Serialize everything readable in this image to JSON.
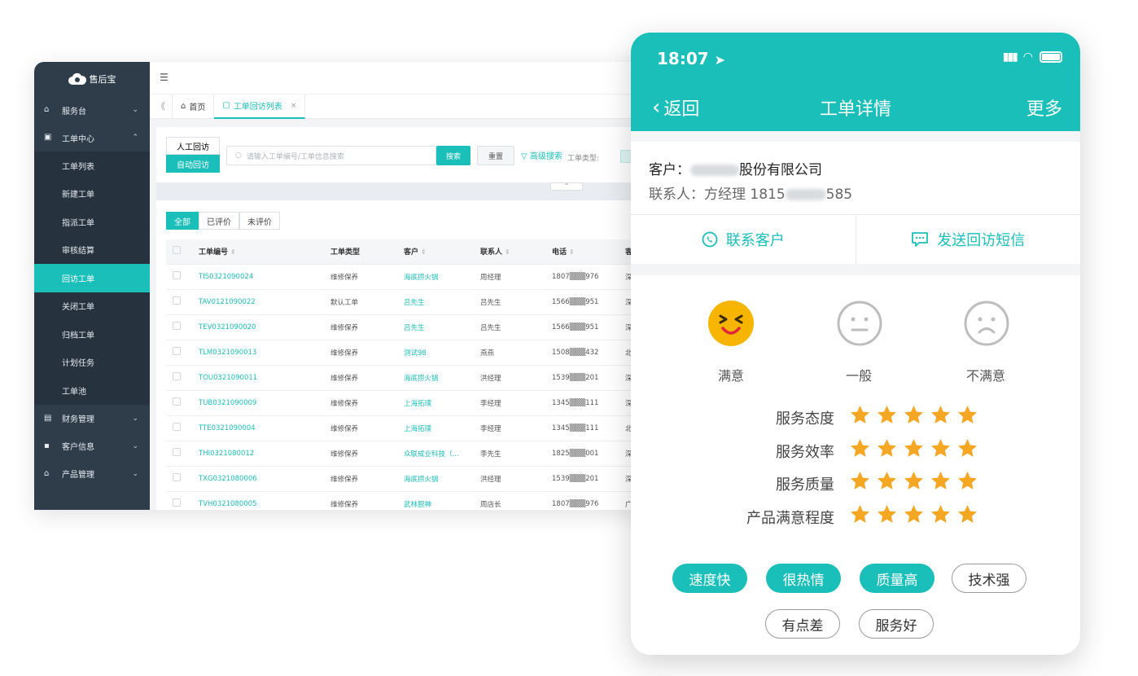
{
  "desktop": {
    "brand": "售后宝",
    "sidebar": {
      "items": [
        {
          "label": "服务台",
          "icon": "home-icon",
          "chevron": "⌄"
        },
        {
          "label": "工单中心",
          "icon": "clipboard-icon",
          "chevron": "⌃"
        },
        {
          "label": "工单列表",
          "sub": true
        },
        {
          "label": "新建工单",
          "sub": true
        },
        {
          "label": "指派工单",
          "sub": true
        },
        {
          "label": "审核结算",
          "sub": true
        },
        {
          "label": "回访工单",
          "sub": true,
          "active": true
        },
        {
          "label": "关闭工单",
          "sub": true
        },
        {
          "label": "归档工单",
          "sub": true
        },
        {
          "label": "计划任务",
          "sub": true
        },
        {
          "label": "工单池",
          "sub": true
        },
        {
          "label": "财务管理",
          "icon": "finance-icon",
          "chevron": "⌄"
        },
        {
          "label": "客户信息",
          "icon": "customer-icon",
          "chevron": "⌄"
        },
        {
          "label": "产品管理",
          "icon": "product-icon",
          "chevron": "⌄"
        }
      ]
    },
    "tabs": {
      "back": "《",
      "home": "首页",
      "current": "工单回访列表",
      "close": "×"
    },
    "search": {
      "mode_manual": "人工回访",
      "mode_auto": "自动回访",
      "placeholder": "请输入工单编号/工单信息搜索",
      "search_btn": "搜索",
      "reset_btn": "重置",
      "advanced": "高级搜索",
      "type_label": "工单类型:",
      "collapse": "⌃"
    },
    "filters": [
      "全部",
      "已评价",
      "未评价"
    ],
    "table": {
      "headers": [
        "工单编号",
        "工单类型",
        "客户",
        "联系人",
        "电话",
        "客"
      ],
      "rows": [
        [
          "TIS0321090024",
          "维修保养",
          "海底捞火锅",
          "周经理",
          "1807▒▒▒976",
          "深"
        ],
        [
          "TAV0121090022",
          "默认工单",
          "吕先生",
          "吕先生",
          "1566▒▒▒951",
          "深"
        ],
        [
          "TEV0321090020",
          "维修保养",
          "吕先生",
          "吕先生",
          "1566▒▒▒951",
          "深"
        ],
        [
          "TLM0321090013",
          "维修保养",
          "测试98",
          "燕燕",
          "1508▒▒▒432",
          "北"
        ],
        [
          "TOU0321090011",
          "维修保养",
          "海底捞火锅",
          "洪经理",
          "1539▒▒▒201",
          "深"
        ],
        [
          "TUB0321090009",
          "维修保养",
          "上海拓璞",
          "李经理",
          "1345▒▒▒111",
          "深"
        ],
        [
          "TTE0321090004",
          "维修保养",
          "上海拓璞",
          "李经理",
          "1345▒▒▒111",
          "北"
        ],
        [
          "THI0321080012",
          "维修保养",
          "众联成业科技（...",
          "李先生",
          "1825▒▒▒001",
          "深"
        ],
        [
          "TXG0321080006",
          "维修保养",
          "海底捞火锅",
          "洪经理",
          "1539▒▒▒201",
          "深"
        ],
        [
          "TVH0321080005",
          "维修保养",
          "武林厨神",
          "周店长",
          "1807▒▒▒976",
          "广"
        ]
      ]
    }
  },
  "phone": {
    "status_time": "18:07",
    "nav": {
      "back": "返回",
      "title": "工单详情",
      "more": "更多"
    },
    "customer": {
      "label": "客户：",
      "name_suffix": "股份有限公司",
      "contact_label": "联系人：",
      "contact_name": "方经理",
      "phone_prefix": "1815",
      "phone_suffix": "585"
    },
    "actions": {
      "call": "联系客户",
      "sms": "发送回访短信"
    },
    "faces": {
      "good": "满意",
      "normal": "一般",
      "bad": "不满意"
    },
    "ratings": [
      {
        "label": "服务态度",
        "stars": 5
      },
      {
        "label": "服务效率",
        "stars": 5
      },
      {
        "label": "服务质量",
        "stars": 5
      },
      {
        "label": "产品满意程度",
        "stars": 5
      }
    ],
    "tags": [
      {
        "label": "速度快",
        "selected": true
      },
      {
        "label": "很热情",
        "selected": true
      },
      {
        "label": "质量高",
        "selected": true
      },
      {
        "label": "技术强",
        "selected": false
      },
      {
        "label": "有点差",
        "selected": false
      },
      {
        "label": "服务好",
        "selected": false
      }
    ],
    "colors": {
      "accent": "#1bbfb9",
      "star": "#f5a623",
      "face_good": "#f7b500",
      "face_neutral": "#bdbdbd"
    }
  }
}
